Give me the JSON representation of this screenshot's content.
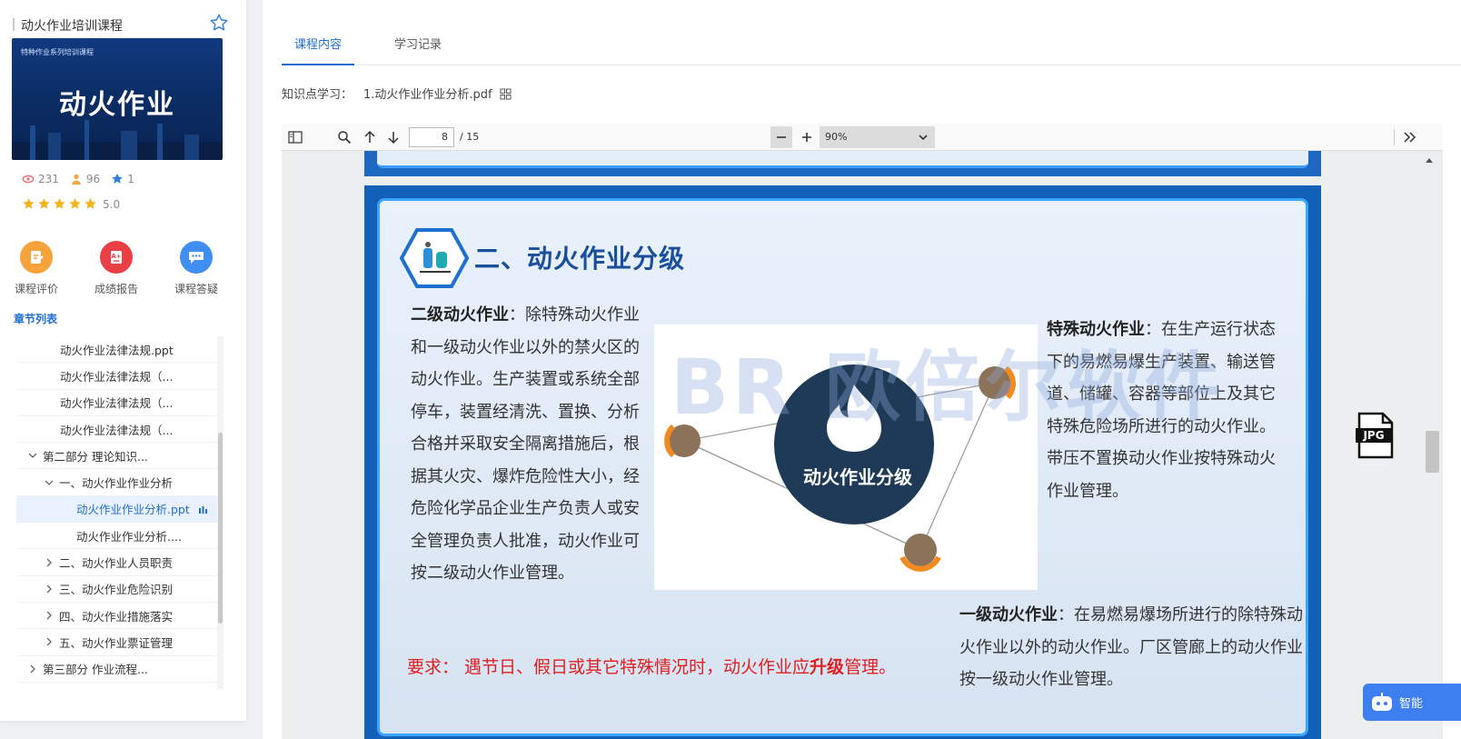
{
  "course": {
    "title": "动火作业培训课程",
    "cover_small": "特种作业系列培训课程",
    "cover_big": "动火作业",
    "views": "231",
    "learners": "96",
    "favorites": "1",
    "rating": "5.0"
  },
  "quick_actions": [
    {
      "label": "课程评价",
      "icon": "review-icon"
    },
    {
      "label": "成绩报告",
      "icon": "report-icon"
    },
    {
      "label": "课程答疑",
      "icon": "chat-icon"
    }
  ],
  "chapter_list_title": "章节列表",
  "tree": [
    {
      "label": "动火作业法律法规.ppt"
    },
    {
      "label": "动火作业法律法规（..."
    },
    {
      "label": "动火作业法律法规（..."
    },
    {
      "label": "动火作业法律法规（..."
    },
    {
      "label": "第二部分 理论知识..."
    },
    {
      "label": "一、动火作业作业分析"
    },
    {
      "label": "动火作业作业分析.ppt"
    },
    {
      "label": "动火作业作业分析...."
    },
    {
      "label": "二、动火作业人员职责"
    },
    {
      "label": "三、动火作业危险识别"
    },
    {
      "label": "四、动火作业措施落实"
    },
    {
      "label": "五、动火作业票证管理"
    },
    {
      "label": "第三部分 作业流程..."
    }
  ],
  "tabs": [
    {
      "label": "课程内容"
    },
    {
      "label": "学习记录"
    }
  ],
  "knowledge": {
    "prefix": "知识点学习：",
    "file": "1.动火作业作业分析.pdf"
  },
  "pdf_toolbar": {
    "page": "8",
    "total": "/ 15",
    "zoom": "90%"
  },
  "slide": {
    "heading": "二、动火作业分级",
    "diagram_center": "动火作业分级",
    "watermark": "BR 欧倍尔软件",
    "left_bold": "二级动火作业",
    "left_text": "：除特殊动火作业和一级动火作业以外的禁火区的动火作业。生产装置或系统全部停车，装置经清洗、置换、分析合格并采取安全隔离措施后，根据其火灾、爆炸危险性大小，经危险化学品企业生产负责人或安全管理负责人批准，动火作业可按二级动火作业管理。",
    "right_bold": "特殊动火作业",
    "right_text": "：在生产运行状态下的易燃易爆生产装置、输送管道、储罐、容器等部位上及其它特殊危险场所进行的动火作业。带压不置换动火作业按特殊动火作业管理。",
    "bottom_bold": "一级动火作业",
    "bottom_text": "：在易燃易爆场所进行的除特殊动火作业以外的动火作业。厂区管廊上的动火作业按一级动火作业管理。",
    "req_prefix": "要求：  遇节日、假日或其它特殊情况时，动火作业应",
    "req_strong": "升级",
    "req_suffix": "管理。"
  },
  "assistant": {
    "label": "智能"
  }
}
